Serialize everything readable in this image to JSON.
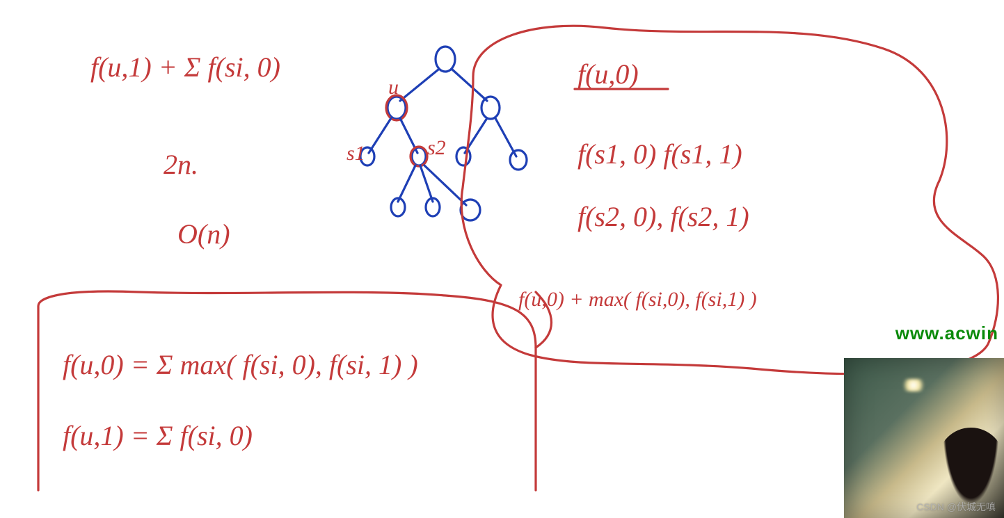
{
  "watermark": "www.acwin",
  "csdn_prefix": "CSDN @",
  "csdn_user": "伏城无嗔",
  "handwriting": {
    "top_left_formula": "f(u,1)  + Σ f(si, 0)",
    "two_n": "2n.",
    "big_o": "O(n)",
    "tree_labels": {
      "u": "u",
      "s1": "s1",
      "s2": "s2"
    },
    "right_block_title": "f(u,0)",
    "right_block_rows": [
      "f(s1, 0)   f(s1, 1)",
      "f(s2, 0),  f(s2, 1)"
    ],
    "right_block_sum": "f(u,0) + max( f(si,0), f(si,1) )",
    "boxed_formulas": [
      "f(u,0) =  Σ max( f(si, 0),  f(si, 1) )",
      "f(u,1) =  Σ  f(si, 0)"
    ]
  },
  "colors": {
    "ink_red": "#c43a3a",
    "ink_blue": "#1e3fb5",
    "green": "#0a8a0a"
  }
}
